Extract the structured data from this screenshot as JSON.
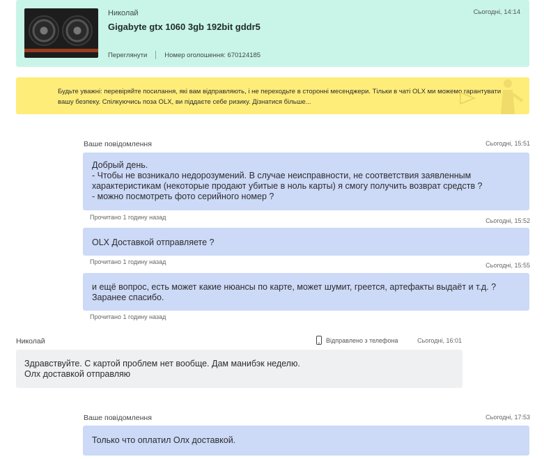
{
  "ad": {
    "seller": "Николай",
    "title": "Gigabyte gtx 1060 3gb 192bit gddr5",
    "time": "Сьогодні, 14:14",
    "view_link": "Переглянути",
    "ad_number": "Номер оголошення: 670124185"
  },
  "warning": {
    "text": "Будьте уважні: перевіряйте посилання, які вам відправляють, і не переходьте в сторонні месенджери. Тільки в чаті OLX ми можемо гарантувати вашу безпеку. Спілкуючись поза OLX, ви піддаєте себе ризику. Дізнатися більше..."
  },
  "messages": [
    {
      "label": "Ваше повідомлення",
      "time": "Сьогодні, 15:51",
      "lines": [
        "Добрый день.",
        "- Чтобы не возникало недорозумений. В случае неисправности, не соответствия заявленным",
        "характеристикам (некоторые продают убитые в ноль карты) я смогу получить возврат средств ?",
        "- можно посмотреть фото серийного номер ?"
      ],
      "read": "Прочитано 1 годину назад"
    },
    {
      "time": "Сьогодні, 15:52",
      "lines": [
        "OLX Доставкой отправляете ?"
      ],
      "read": "Прочитано 1 годину назад"
    },
    {
      "time": "Сьогодні, 15:55",
      "lines": [
        "и ещё вопрос, есть может какие нюансы по карте, может шумит, греется, артефакты выдаёт и т.д. ?",
        "Заранее спасибо."
      ],
      "read": "Прочитано 1 годину назад"
    },
    {
      "label": "Николай",
      "phone_note": "Відправлено з телефона",
      "time": "Сьогодні, 16:01",
      "lines": [
        "Здравствуйте. С картой проблем нет вообще. Дам манибэк неделю.",
        "Олх доставкой отправляю"
      ]
    },
    {
      "label": "Ваше повідомлення",
      "time": "Сьогодні, 17:53",
      "lines": [
        "Только что оплатил Олх доставкой."
      ]
    }
  ],
  "colors": {
    "ad_bg": "#c8f5e8",
    "warning_bg": "#ffed7a",
    "outgoing_bubble": "#ccd9f7",
    "incoming_bubble": "#eef0f2"
  },
  "icons": {
    "phone": "mobile-phone-icon",
    "thumbnail": "graphics-card-thumbnail"
  }
}
